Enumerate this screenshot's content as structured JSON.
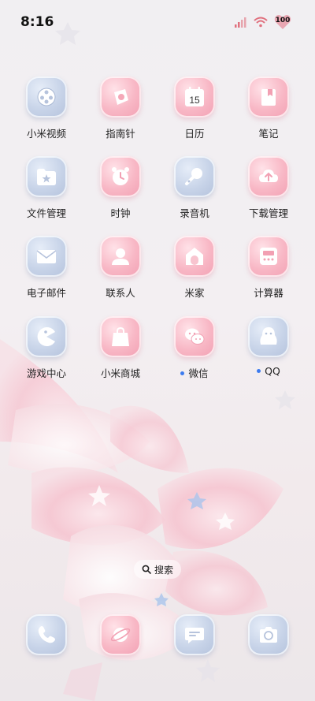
{
  "status_bar": {
    "time": "8:16",
    "battery": "100"
  },
  "apps": [
    {
      "label": "小米视频",
      "icon": "video-reel-icon",
      "style": "blue",
      "badge_dot": false
    },
    {
      "label": "指南针",
      "icon": "compass-icon",
      "style": "pink",
      "badge_dot": false
    },
    {
      "label": "日历",
      "icon": "calendar-icon",
      "style": "pink",
      "badge_dot": false,
      "icon_text": "15"
    },
    {
      "label": "笔记",
      "icon": "notes-icon",
      "style": "pink",
      "badge_dot": false
    },
    {
      "label": "文件管理",
      "icon": "folder-star-icon",
      "style": "blue",
      "badge_dot": false
    },
    {
      "label": "时钟",
      "icon": "alarm-clock-icon",
      "style": "pink",
      "badge_dot": false
    },
    {
      "label": "录音机",
      "icon": "microphone-icon",
      "style": "blue",
      "badge_dot": false
    },
    {
      "label": "下载管理",
      "icon": "cloud-upload-icon",
      "style": "pink",
      "badge_dot": false
    },
    {
      "label": "电子邮件",
      "icon": "mail-icon",
      "style": "blue",
      "badge_dot": false
    },
    {
      "label": "联系人",
      "icon": "contact-icon",
      "style": "pink",
      "badge_dot": false
    },
    {
      "label": "米家",
      "icon": "home-icon",
      "style": "pink",
      "badge_dot": false
    },
    {
      "label": "计算器",
      "icon": "calculator-icon",
      "style": "pink",
      "badge_dot": false
    },
    {
      "label": "游戏中心",
      "icon": "pacman-icon",
      "style": "blue",
      "badge_dot": false
    },
    {
      "label": "小米商城",
      "icon": "shopping-bag-icon",
      "style": "pink",
      "badge_dot": false
    },
    {
      "label": "微信",
      "icon": "wechat-icon",
      "style": "pink",
      "badge_dot": true
    },
    {
      "label": "QQ",
      "icon": "penguin-icon",
      "style": "blue",
      "badge_dot": true
    }
  ],
  "search": {
    "label": "搜索"
  },
  "dock": [
    {
      "icon": "phone-icon",
      "style": "blue"
    },
    {
      "icon": "browser-planet-icon",
      "style": "pink"
    },
    {
      "icon": "message-icon",
      "style": "blue"
    },
    {
      "icon": "camera-icon",
      "style": "blue"
    }
  ],
  "colors": {
    "icon_blue": "#c7d3e8",
    "icon_pink": "#f8b7c5",
    "notify_dot": "#3c7bef"
  }
}
